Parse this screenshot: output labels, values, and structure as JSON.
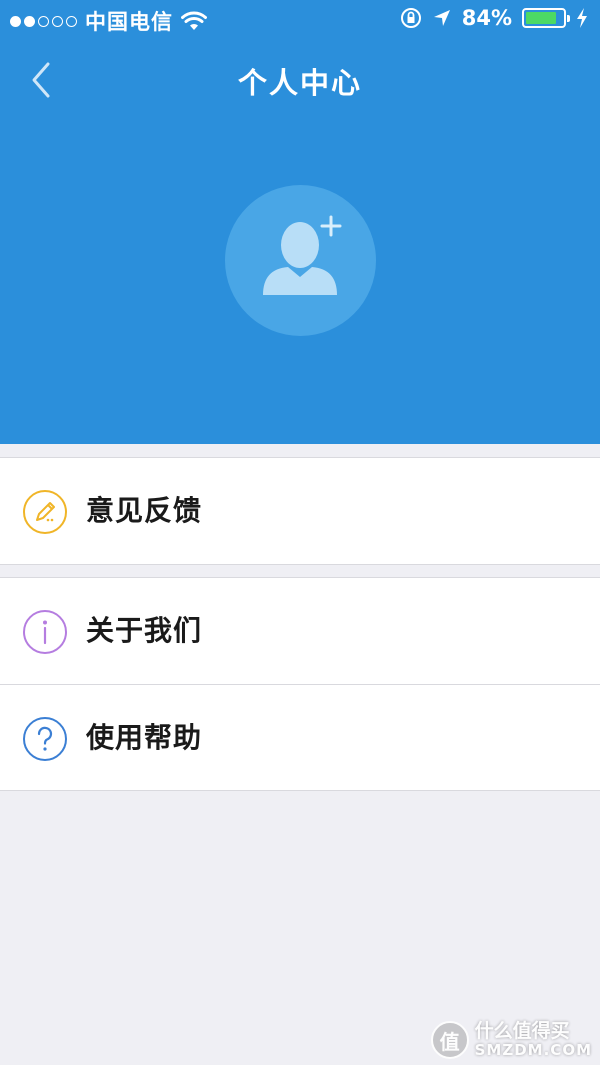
{
  "status_bar": {
    "carrier": "中国电信",
    "battery_percent": "84%",
    "battery_level": 0.84
  },
  "nav": {
    "title": "个人中心",
    "back_icon": "chevron-left-icon"
  },
  "profile": {
    "avatar_icon": "add-user-icon"
  },
  "menu": {
    "group1": [
      {
        "label": "意见反馈",
        "icon": "pencil-icon",
        "color": "#f0b528"
      }
    ],
    "group2": [
      {
        "label": "关于我们",
        "icon": "info-icon",
        "color": "#b57de0"
      },
      {
        "label": "使用帮助",
        "icon": "question-icon",
        "color": "#3b7fd4"
      }
    ]
  },
  "watermark": {
    "badge": "值",
    "cn": "什么值得买",
    "en": "SMZDM.COM"
  },
  "colors": {
    "header_bg": "#2b8fdb",
    "avatar_bg": "#49a6e6",
    "page_bg": "#efeff4"
  }
}
